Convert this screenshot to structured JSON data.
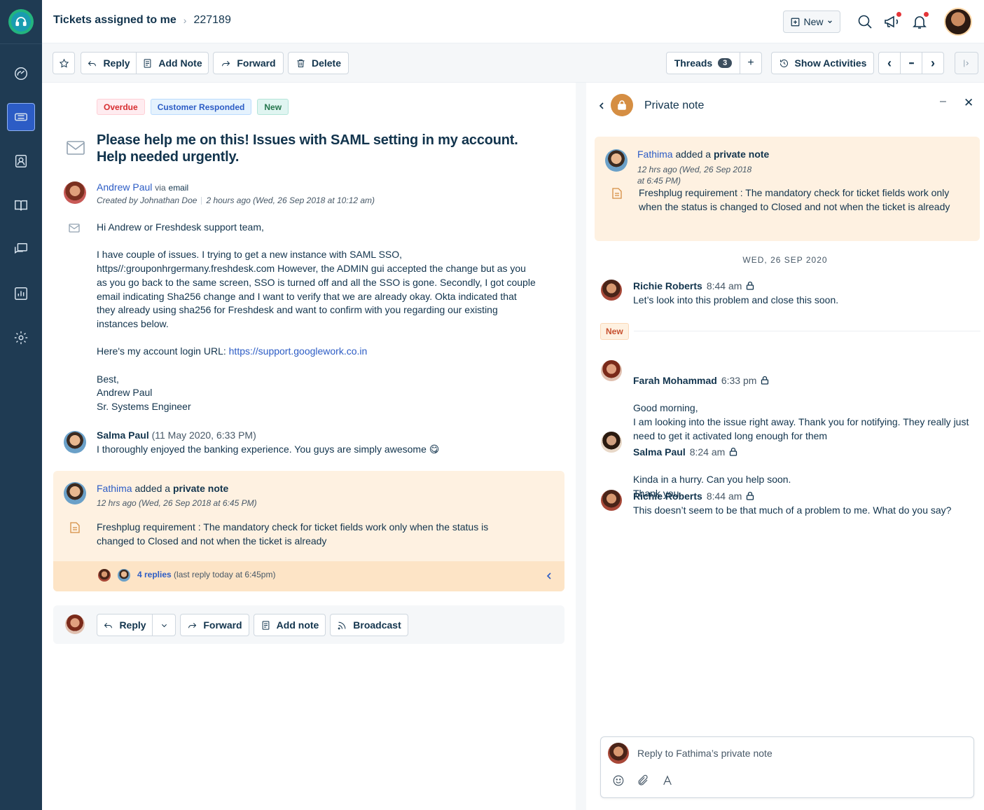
{
  "header": {
    "breadcrumb_root": "Tickets assigned to me",
    "breadcrumb_sep": "›",
    "ticket_id": "227189",
    "new_label": "New"
  },
  "toolbar": {
    "reply": "Reply",
    "add_note": "Add Note",
    "forward": "Forward",
    "delete": "Delete",
    "threads": "Threads",
    "threads_count": "3",
    "plus": "+",
    "show_activities": "Show Activities",
    "prev": "‹",
    "more": "•••",
    "next": "›"
  },
  "ticket": {
    "tags": [
      "Overdue",
      "Customer Responded",
      "New"
    ],
    "subject": "Please help me on this! Issues with SAML setting in my account. Help needed urgently.",
    "author": "Andrew Paul",
    "via_prefix": "via",
    "via_channel": "email",
    "created_by": "Created by Johnathan Doe",
    "created_time": "2 hours ago (Wed, 26 Sep 2018 at 10:12 am)",
    "body_greeting": "Hi Andrew or Freshdesk support team,",
    "body_para1": "I have couple of issues. I trying to get a new instance with SAML SSO, https//:grouponhrgermany.freshdesk.com However, the ADMIN gui accepted the change but as you as you go back to the same screen, SSO is turned off and all the SSO is gone. Secondly, I got couple email indicating Sha256 change and I want to verify that we are already okay. Okta indicated that they already using sha256 for Freshdesk and want to confirm with you regarding our existing instances below.",
    "body_url_prefix": "Here's my account login URL:",
    "body_url": "https://support.googlework.co.in",
    "sign_best": "Best,",
    "sign_name": "Andrew Paul",
    "sign_title": "Sr. Systems Engineer"
  },
  "conversation_reply": {
    "author": "Salma Paul",
    "time": "(11 May 2020, 6:33 PM)",
    "text": "I thoroughly enjoyed the banking experience. You guys are simply awesome 😋"
  },
  "private_note": {
    "author": "Fathima",
    "action_mid": "added a",
    "action_bold": "private note",
    "meta": "12 hrs ago (Wed, 26 Sep 2018 at 6:45 PM)",
    "body": "Freshplug requirement : The mandatory check for ticket fields work only when the status is changed to Closed and not when the ticket is already",
    "replies_link": "4 replies",
    "replies_meta": "(last reply today at 6:45pm)"
  },
  "reply_bar": {
    "reply": "Reply",
    "forward": "Forward",
    "add_note": "Add note",
    "broadcast": "Broadcast"
  },
  "right_panel": {
    "title": "Private note",
    "minimize": "–",
    "close": "✕",
    "note_author": "Fathima",
    "note_action_mid": "added a",
    "note_action_bold": "private note",
    "note_meta": "12 hrs ago (Wed, 26 Sep 2018 at 6:45 PM)",
    "note_body": "Freshplug requirement : The mandatory check for ticket fields work only when the status is changed to Closed and not when the ticket is already",
    "date_separator": "WED, 26 SEP 2020",
    "new_marker": "New",
    "messages": [
      {
        "name": "Richie Roberts",
        "time": "8:44 am",
        "text": "Let’s look into this problem and close this soon."
      },
      {
        "name": "Farah Mohammad",
        "time": "6:33 pm",
        "text": "Good morning,\nI am looking into the issue right away. Thank you for notifying. They really just need to get it activated long enough for them"
      },
      {
        "name": "Salma Paul",
        "time": "8:24 am",
        "text": "Kinda in a hurry. Can you help soon.\nThank you."
      },
      {
        "name": "Richie Roberts",
        "time": "8:44 am",
        "text": "This doesn’t seem to be that much of a problem to me. What do you say?"
      }
    ],
    "reply_placeholder": "Reply to Fathima’s private note"
  },
  "colors": {
    "sidebar": "#1f3b53",
    "accent": "#2c5cc5",
    "note_bg": "#fef1e1"
  }
}
